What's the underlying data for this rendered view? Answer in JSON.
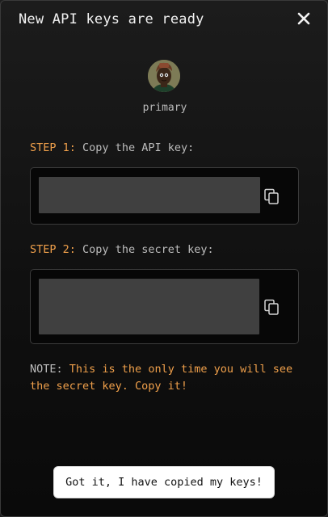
{
  "dialog": {
    "title": "New API keys are ready",
    "close_icon": "close-icon"
  },
  "account": {
    "name": "primary",
    "avatar_icon": "user-avatar"
  },
  "steps": [
    {
      "label": "STEP 1:",
      "text": "Copy the API key:",
      "copy_icon": "copy-icon"
    },
    {
      "label": "STEP 2:",
      "text": "Copy the secret key:",
      "copy_icon": "copy-icon"
    }
  ],
  "note": {
    "prefix": "NOTE:",
    "warning": "This is the only time you will see the secret key. Copy it!"
  },
  "confirm_button": {
    "label": "Got it, I have copied my keys!"
  },
  "colors": {
    "accent": "#f0a04b",
    "background": "#111111",
    "key_field": "#404040",
    "text_muted": "#bdbdbd"
  }
}
